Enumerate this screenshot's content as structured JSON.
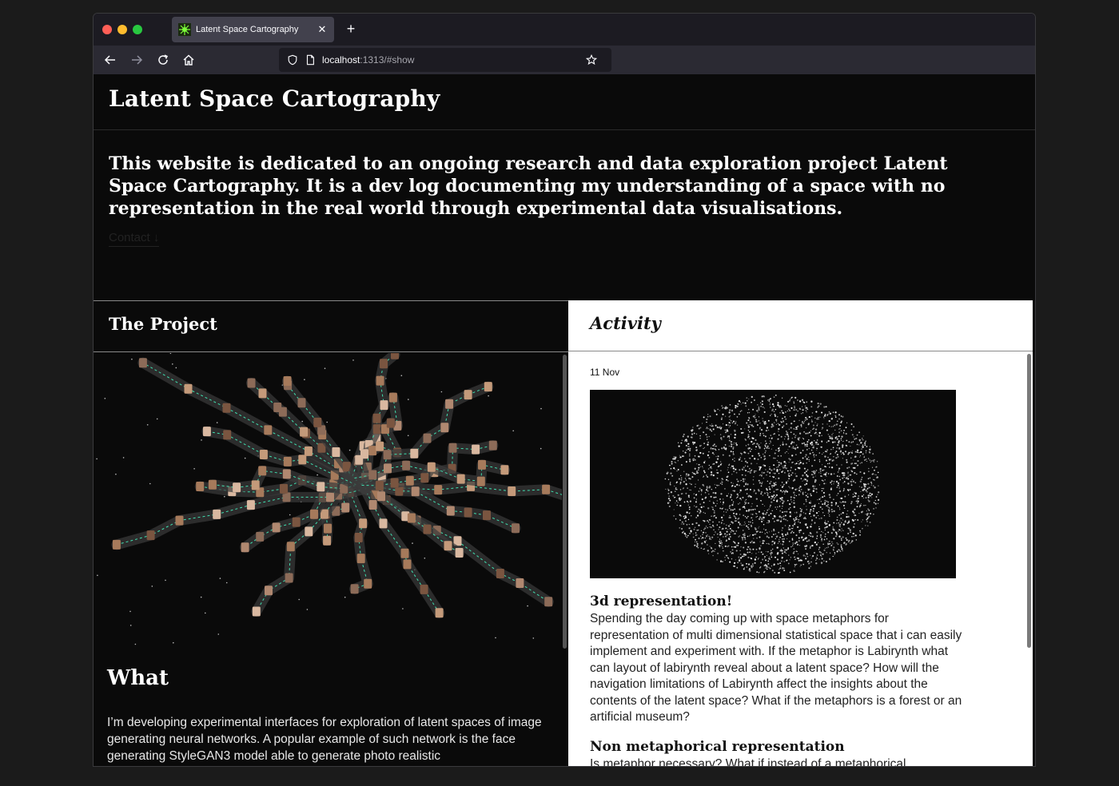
{
  "browser": {
    "tab_title": "Latent Space Cartography",
    "url_host": "localhost",
    "url_path": ":1313/#show",
    "icons": [
      "back-icon",
      "forward-icon",
      "reload-icon",
      "home-icon",
      "shield-icon",
      "page-icon",
      "star-icon",
      "close-icon",
      "plus-icon"
    ]
  },
  "site": {
    "title": "Latent Space Cartography",
    "intro": "This website is dedicated to an ongoing research and data exploration project Latent Space Cartography. It is a dev log documenting my understanding of a space with no representation in the real world through experimental data visualisations.",
    "contact": "Contact ↓"
  },
  "project": {
    "heading": "The Project",
    "what_title": "What",
    "what_text": "I’m developing experimental interfaces for exploration of latent spaces of image generating neural networks. A popular example of such network is the face generating StyleGAN3 model able to generate photo realistic"
  },
  "activity": {
    "heading": "Activity",
    "entries": [
      {
        "date": "11 Nov",
        "title": "3d representation!",
        "text": "Spending the day coming up with space metaphors for representation of multi dimensional statistical space that i can easily implement and experiment with. If the metaphor is Labirynth what can layout of labirynth reveal about a latent space? How will the navigation limitations of Labirynth affect the insights about the contents of the latent space? What if the metaphors is a forest or an artificial museum?"
      },
      {
        "title": "Non metaphorical representation",
        "text": "Is metaphor necessary? What if instead of a metaphorical"
      }
    ]
  },
  "colors": {
    "page_bg": "#0a0a0a",
    "activity_bg": "#ffffff",
    "path_accent": "#40e0b0"
  }
}
